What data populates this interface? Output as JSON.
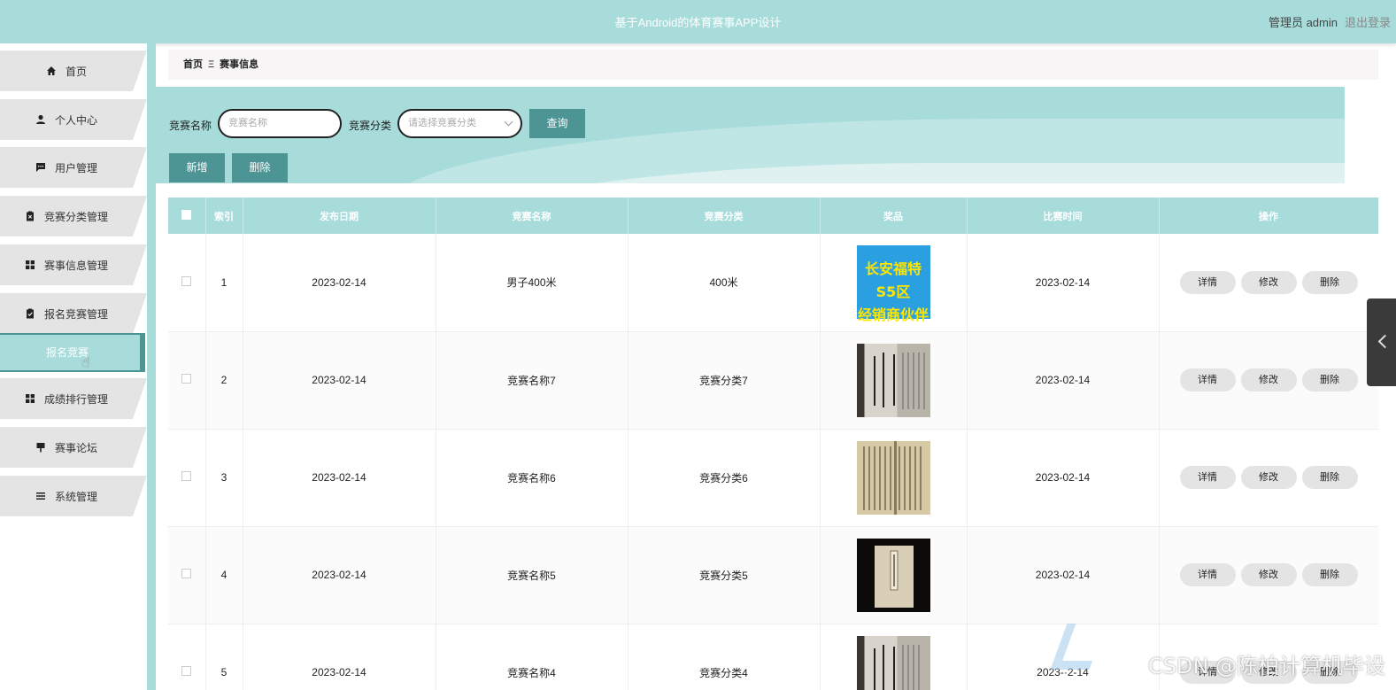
{
  "header": {
    "title": "基于Android的体育赛事APP设计",
    "user_label": "管理员 admin",
    "logout_label": "退出登录"
  },
  "sidebar": {
    "items": [
      {
        "label": "首页",
        "icon": "home-icon"
      },
      {
        "label": "个人中心",
        "icon": "person-icon"
      },
      {
        "label": "用户管理",
        "icon": "chat-icon"
      },
      {
        "label": "竞赛分类管理",
        "icon": "clipboard-x-icon"
      },
      {
        "label": "赛事信息管理",
        "icon": "grid-icon"
      },
      {
        "label": "报名竞赛管理",
        "icon": "clipboard-check-icon"
      },
      {
        "label": "成绩排行管理",
        "icon": "grid-icon"
      },
      {
        "label": "赛事论坛",
        "icon": "signpost-icon"
      },
      {
        "label": "系统管理",
        "icon": "list-icon"
      }
    ],
    "sub_item": {
      "label": "报名竞赛"
    }
  },
  "breadcrumb": {
    "home": "首页",
    "separator": "Ξ",
    "current": "赛事信息"
  },
  "search": {
    "name_label": "竞赛名称",
    "name_placeholder": "竞赛名称",
    "category_label": "竞赛分类",
    "category_placeholder": "请选择竞赛分类",
    "query_button": "查询",
    "add_button": "新增",
    "delete_button": "删除"
  },
  "table": {
    "columns": [
      "索引",
      "发布日期",
      "竞赛名称",
      "竞赛分类",
      "奖品",
      "比赛时间",
      "操作"
    ],
    "rows": [
      {
        "index": "1",
        "publish_date": "2023-02-14",
        "name": "男子400米",
        "category": "400米",
        "prize_image": "ad-banner-image",
        "prize_text_line1": "长安福特S5区",
        "prize_text_line2": "经销商伙伴",
        "match_time": "2023-02-14"
      },
      {
        "index": "2",
        "publish_date": "2023-02-14",
        "name": "竞赛名称7",
        "category": "竞赛分类7",
        "prize_image": "book-page-image",
        "match_time": "2023-02-14"
      },
      {
        "index": "3",
        "publish_date": "2023-02-14",
        "name": "竞赛名称6",
        "category": "竞赛分类6",
        "prize_image": "book-page-image",
        "match_time": "2023-02-14"
      },
      {
        "index": "4",
        "publish_date": "2023-02-14",
        "name": "竞赛名称5",
        "category": "竞赛分类5",
        "prize_image": "book-cover-image",
        "match_time": "2023-02-14"
      },
      {
        "index": "5",
        "publish_date": "2023-02-14",
        "name": "竞赛名称4",
        "category": "竞赛分类4",
        "prize_image": "book-page-image",
        "match_time": "2023-·2-14"
      }
    ],
    "actions": {
      "detail": "详情",
      "edit": "修改",
      "delete": "删除"
    }
  },
  "watermark": "CSDN @陈柏计算机毕设",
  "colors": {
    "primary": "#a7dcdb",
    "button": "#4d9494",
    "nav": "#e4e4e4"
  }
}
